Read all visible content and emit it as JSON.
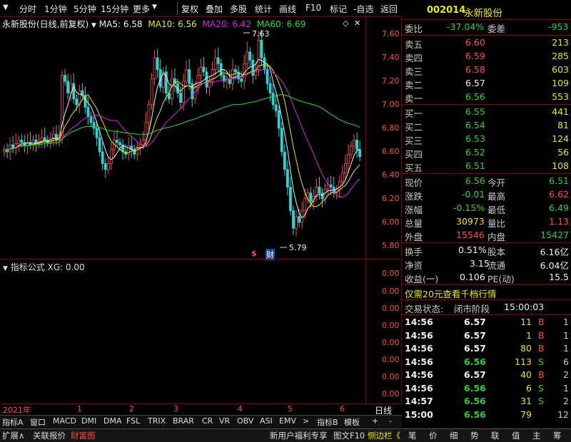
{
  "toolbar": {
    "left_items": [
      "分时",
      "1分钟",
      "5分钟",
      "15分钟",
      "更多"
    ],
    "right_items": [
      "复权",
      "叠加",
      "多股",
      "统计",
      "画线",
      "F10",
      "标记",
      "-自选",
      "返回"
    ]
  },
  "chart_header": {
    "stock_name": "永新股份(日线,前复权)",
    "ma5_label": "MA5:",
    "ma5_value": "6.58",
    "ma10_label": "MA10:",
    "ma10_value": "6.56",
    "ma20_label": "MA20:",
    "ma20_value": "6.42",
    "ma60_label": "MA60:",
    "ma60_value": "6.69"
  },
  "chart_annotations": {
    "high_label": "7.63",
    "low_label": "5.79",
    "marker_dollar": "$",
    "marker_cai": "财"
  },
  "y_ticks": [
    "7.60",
    "7.40",
    "7.20",
    "7.00",
    "6.80",
    "6.60",
    "6.40",
    "6.20",
    "6.00",
    "5.80"
  ],
  "indicator": {
    "title": "指标公式",
    "name": "XG: 0.00",
    "ticks": [
      "0.00",
      "0.00",
      "0.00",
      "0.00",
      "0.00",
      "0.00",
      "0.00",
      "0.00"
    ]
  },
  "date_row": {
    "year": "2021年",
    "months": [
      "1",
      "2",
      "3",
      "4",
      "5",
      "6"
    ],
    "period": "日线"
  },
  "indicator_tabs": [
    "指标A",
    "窗口",
    "MACD",
    "DMI",
    "DMA",
    "FSL",
    "TRIX",
    "BRAR",
    "CR",
    "VR",
    "OBV",
    "ASI",
    "EMV",
    ">",
    "指标B",
    "模板",
    "+",
    "-"
  ],
  "bottom_left": [
    "扩展∧",
    "关联报价",
    "财富图"
  ],
  "bottom_mid": [
    "新用户福利专享",
    "图文F10",
    "侧边栏《"
  ],
  "bottom_right": [
    "笔",
    "价",
    "细",
    "势",
    "联",
    "值",
    "主",
    "筹"
  ],
  "quote": {
    "code": "002014",
    "name": "永新股份",
    "weibi_label": "委比",
    "weibi_value": "-37.04%",
    "weicha_label": "委差",
    "weicha_value": "-953",
    "asks": [
      {
        "label": "卖五",
        "price": "6.60",
        "vol": "213"
      },
      {
        "label": "卖四",
        "price": "6.59",
        "vol": "285"
      },
      {
        "label": "卖三",
        "price": "6.58",
        "vol": "603"
      },
      {
        "label": "卖二",
        "price": "6.57",
        "vol": "109"
      },
      {
        "label": "卖一",
        "price": "6.56",
        "vol": "553"
      }
    ],
    "bids": [
      {
        "label": "买一",
        "price": "6.55",
        "vol": "441"
      },
      {
        "label": "买二",
        "price": "6.54",
        "vol": "81"
      },
      {
        "label": "买三",
        "price": "6.53",
        "vol": "124"
      },
      {
        "label": "买四",
        "price": "6.52",
        "vol": "56"
      },
      {
        "label": "买五",
        "price": "6.51",
        "vol": "108"
      }
    ],
    "stats": [
      {
        "l1": "现价",
        "v1": "6.56",
        "l2": "今开",
        "v2": "6.51"
      },
      {
        "l1": "涨跌",
        "v1": "-0.01",
        "l2": "最高",
        "v2": "6.62"
      },
      {
        "l1": "涨幅",
        "v1": "-0.15%",
        "l2": "最低",
        "v2": "6.49"
      },
      {
        "l1": "总量",
        "v1": "30973",
        "l2": "量比",
        "v2": "1.13"
      },
      {
        "l1": "外盘",
        "v1": "15546",
        "l2": "内盘",
        "v2": "15427"
      }
    ],
    "stats2": [
      {
        "l1": "换手",
        "v1": "0.51%",
        "l2": "股本",
        "v2": "6.16亿"
      },
      {
        "l1": "净资",
        "v1": "3.15",
        "l2": "流通",
        "v2": "6.04亿"
      },
      {
        "l1": "收益(一)",
        "v1": "0.106",
        "l2": "PE(动)",
        "v2": "15.5"
      }
    ],
    "promo": "仅需20元查看千档行情",
    "status_label": "交易状态:",
    "status_value": "闭市阶段",
    "status_time": "15:00:03"
  },
  "ticks_list": [
    {
      "time": "14:56",
      "price": "6.57",
      "vol": "11",
      "side": "B",
      "n": "1"
    },
    {
      "time": "14:56",
      "price": "6.57",
      "vol": "1",
      "side": "B",
      "n": "1"
    },
    {
      "time": "14:56",
      "price": "6.57",
      "vol": "80",
      "side": "B",
      "n": "1"
    },
    {
      "time": "14:56",
      "price": "6.56",
      "vol": "113",
      "side": "S",
      "n": "6"
    },
    {
      "time": "14:56",
      "price": "6.57",
      "vol": "40",
      "side": "B",
      "n": "2"
    },
    {
      "time": "14:56",
      "price": "6.56",
      "vol": "6",
      "side": "S",
      "n": "1"
    },
    {
      "time": "14:57",
      "price": "6.56",
      "vol": "31",
      "side": "S",
      "n": "2"
    },
    {
      "time": "15:00",
      "price": "6.56",
      "vol": "79",
      "side": "",
      "n": "12"
    }
  ],
  "colors": {
    "up": "#ff4b4b",
    "down": "#2bd12b",
    "ma5": "#f0f0f0",
    "ma10": "#e8e800",
    "ma20": "#e020e0",
    "ma60": "#20e020",
    "border": "#8b0000"
  }
}
